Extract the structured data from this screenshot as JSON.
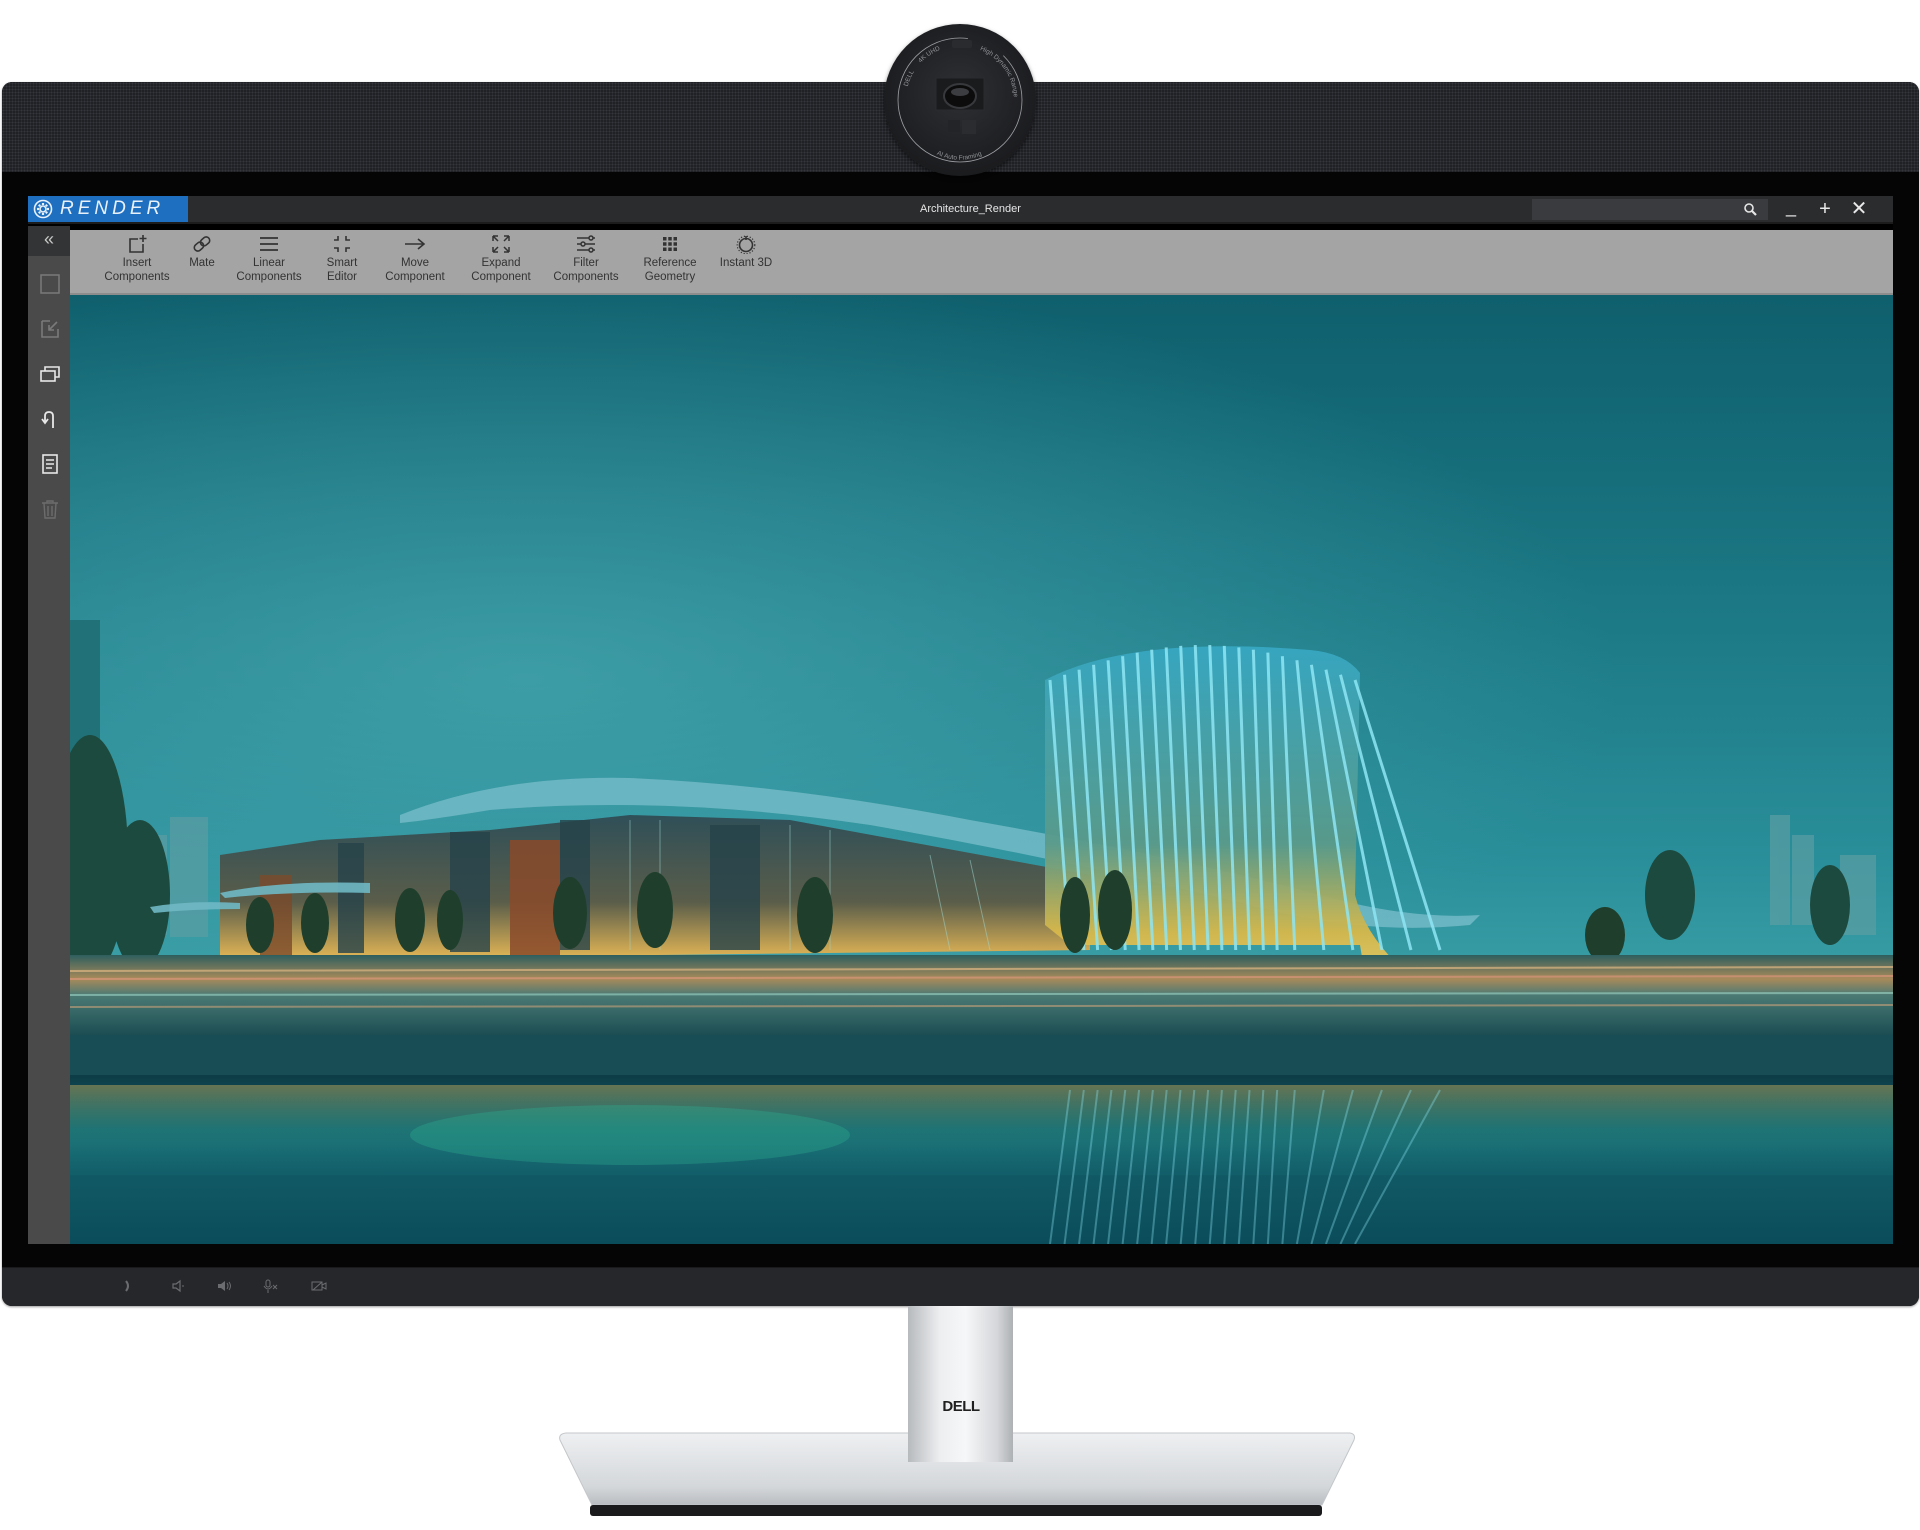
{
  "device": {
    "brand_logo": "DELL",
    "camera_ring_text": [
      "DELL",
      "4K UHD",
      "High Dynamic Range",
      "AI Auto Framing"
    ],
    "bezel_controls": [
      {
        "name": "phone-icon",
        "glyph": "☎"
      },
      {
        "name": "volume-down-icon",
        "glyph": "◁"
      },
      {
        "name": "volume-up-icon",
        "glyph": "◀"
      },
      {
        "name": "mic-mute-icon",
        "glyph": "✕"
      },
      {
        "name": "camera-off-icon",
        "glyph": "▭"
      }
    ]
  },
  "app": {
    "logo_text": "RENDER",
    "window_title": "Architecture_Render",
    "search": {
      "placeholder": "",
      "value": ""
    },
    "window_controls": {
      "minimize": "_",
      "maximize": "+",
      "close": "✕"
    },
    "brand_color": "#1f6fc0"
  },
  "sidebar": {
    "collapse_label": "«",
    "items": [
      {
        "name": "select-box-icon",
        "enabled": false
      },
      {
        "name": "import-icon",
        "enabled": false
      },
      {
        "name": "windows-icon",
        "enabled": true
      },
      {
        "name": "undo-icon",
        "enabled": true
      },
      {
        "name": "document-icon",
        "enabled": true
      },
      {
        "name": "trash-icon",
        "enabled": false
      }
    ]
  },
  "toolbar": {
    "items": [
      {
        "id": "insert-components",
        "line1": "Insert",
        "line2": "Components",
        "icon": "insert-icon"
      },
      {
        "id": "mate",
        "line1": "Mate",
        "line2": "",
        "icon": "link-icon"
      },
      {
        "id": "linear-components",
        "line1": "Linear",
        "line2": "Components",
        "icon": "menu-lines-icon"
      },
      {
        "id": "smart-editor",
        "line1": "Smart",
        "line2": "Editor",
        "icon": "corners-icon"
      },
      {
        "id": "move-component",
        "line1": "Move",
        "line2": "Component",
        "icon": "arrow-right-icon"
      },
      {
        "id": "expand-component",
        "line1": "Expand",
        "line2": "Component",
        "icon": "expand-icon"
      },
      {
        "id": "filter-components",
        "line1": "Filter",
        "line2": "Components",
        "icon": "sliders-icon"
      },
      {
        "id": "reference-geometry",
        "line1": "Reference",
        "line2": "Geometry",
        "icon": "grid-icon"
      },
      {
        "id": "instant-3d",
        "line1": "Instant 3D",
        "line2": "",
        "icon": "dial-icon"
      }
    ]
  },
  "viewport": {
    "content": "architectural-render-night-scene",
    "sky_colors": [
      "#1a6f7c",
      "#2b8f9b",
      "#3aa0a8"
    ],
    "water_color": "#0e4d58"
  }
}
